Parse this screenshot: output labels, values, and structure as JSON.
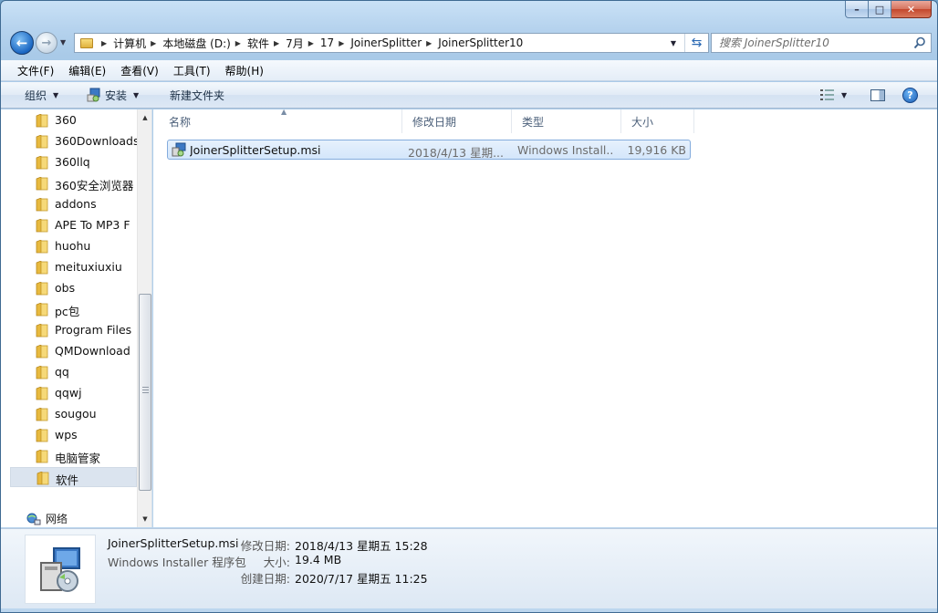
{
  "window": {
    "caption": {
      "minimize": "–",
      "maximize": "□",
      "close": "✕"
    }
  },
  "nav": {
    "back": "←",
    "forward": "→",
    "breadcrumbs": [
      "计算机",
      "本地磁盘 (D:)",
      "软件",
      "7月",
      "17",
      "JoinerSplitter",
      "JoinerSplitter10"
    ],
    "search_placeholder": "搜索 JoinerSplitter10"
  },
  "menubar": [
    "文件(F)",
    "编辑(E)",
    "查看(V)",
    "工具(T)",
    "帮助(H)"
  ],
  "commandbar": {
    "organize": "组织",
    "install": "安装",
    "new_folder": "新建文件夹",
    "help": "?"
  },
  "tree": [
    "360",
    "360Downloads",
    "360llq",
    "360安全浏览器",
    "addons",
    "APE To MP3 F",
    "huohu",
    "meituxiuxiu",
    "obs",
    "pc包",
    "Program Files",
    "QMDownload",
    "qq",
    "qqwj",
    "sougou",
    "wps",
    "电脑管家",
    "软件"
  ],
  "tree_selected": "软件",
  "network": "网络",
  "columns": {
    "name": "名称",
    "date": "修改日期",
    "type": "类型",
    "size": "大小"
  },
  "files": [
    {
      "name": "JoinerSplitterSetup.msi",
      "date": "2018/4/13 星期...",
      "type": "Windows Install...",
      "size": "19,916 KB"
    }
  ],
  "details": {
    "name": "JoinerSplitterSetup.msi",
    "kind": "Windows Installer 程序包",
    "modified_label": "修改日期:",
    "modified": "2018/4/13 星期五 15:28",
    "size_label": "大小:",
    "size": "19.4 MB",
    "created_label": "创建日期:",
    "created": "2020/7/17 星期五 11:25"
  },
  "colors": {
    "selection_border": "#84acdd",
    "selection_fill": "#d4e6fb",
    "title_glass": "#b6d3ee"
  }
}
